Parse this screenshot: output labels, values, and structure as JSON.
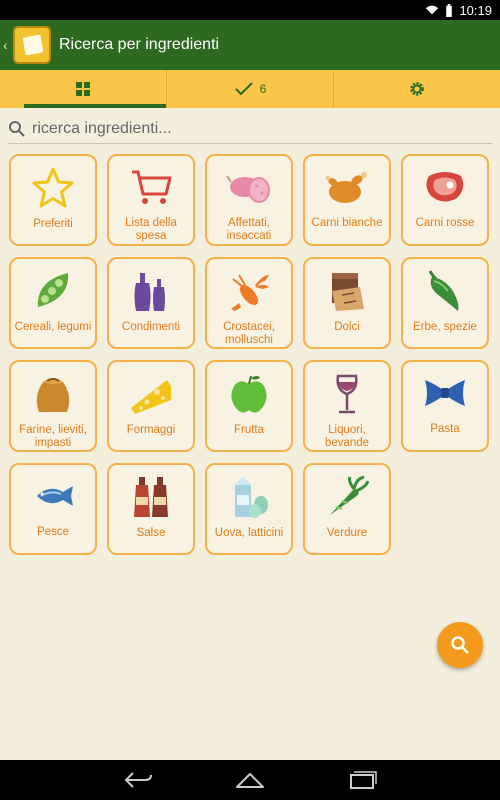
{
  "status_bar": {
    "time": "10:19",
    "icons": [
      "wifi-icon",
      "battery-icon"
    ]
  },
  "action_bar": {
    "title": "Ricerca per ingredienti",
    "logo": "app-logo-icon"
  },
  "tabs": [
    {
      "icon": "grid-icon",
      "label": ""
    },
    {
      "icon": "checkmark-icon",
      "label": "6"
    },
    {
      "icon": "gear-icon",
      "label": ""
    }
  ],
  "search": {
    "placeholder": "ricerca ingredienti..."
  },
  "categories": [
    {
      "label": "Preferiti",
      "icon": "star-icon"
    },
    {
      "label": "Lista della spesa",
      "icon": "shopping-cart-icon"
    },
    {
      "label": "Affettati, insaccati",
      "icon": "salami-icon"
    },
    {
      "label": "Carni bianche",
      "icon": "roast-chicken-icon"
    },
    {
      "label": "Carni rosse",
      "icon": "steak-icon"
    },
    {
      "label": "Cereali, legumi",
      "icon": "pea-pod-icon"
    },
    {
      "label": "Condimenti",
      "icon": "oil-bottles-icon"
    },
    {
      "label": "Crostacei, molluschi",
      "icon": "lobster-icon"
    },
    {
      "label": "Dolci",
      "icon": "chocolate-icon"
    },
    {
      "label": "Erbe, spezie",
      "icon": "chili-pepper-icon"
    },
    {
      "label": "Farine, lieviti, impasti",
      "icon": "flour-sack-icon"
    },
    {
      "label": "Formaggi",
      "icon": "cheese-icon"
    },
    {
      "label": "Frutta",
      "icon": "apple-icon"
    },
    {
      "label": "Liquori, bevande",
      "icon": "wine-glass-icon"
    },
    {
      "label": "Pasta",
      "icon": "farfalle-icon"
    },
    {
      "label": "Pesce",
      "icon": "fish-icon"
    },
    {
      "label": "Salse",
      "icon": "sauce-bottles-icon"
    },
    {
      "label": "Uova, latticini",
      "icon": "milk-eggs-icon"
    },
    {
      "label": "Verdure",
      "icon": "carrot-icon"
    }
  ],
  "fab": {
    "icon": "search-icon"
  },
  "nav_bar": {
    "icons": [
      "back-icon",
      "home-icon",
      "recent-apps-icon"
    ]
  },
  "colors": {
    "action_bar": "#2d6a1f",
    "tab_bar": "#f9c64a",
    "tile_border": "#f5b14a",
    "label": "#e07d1a",
    "fab": "#f49b1d",
    "background": "#f4eedd"
  }
}
